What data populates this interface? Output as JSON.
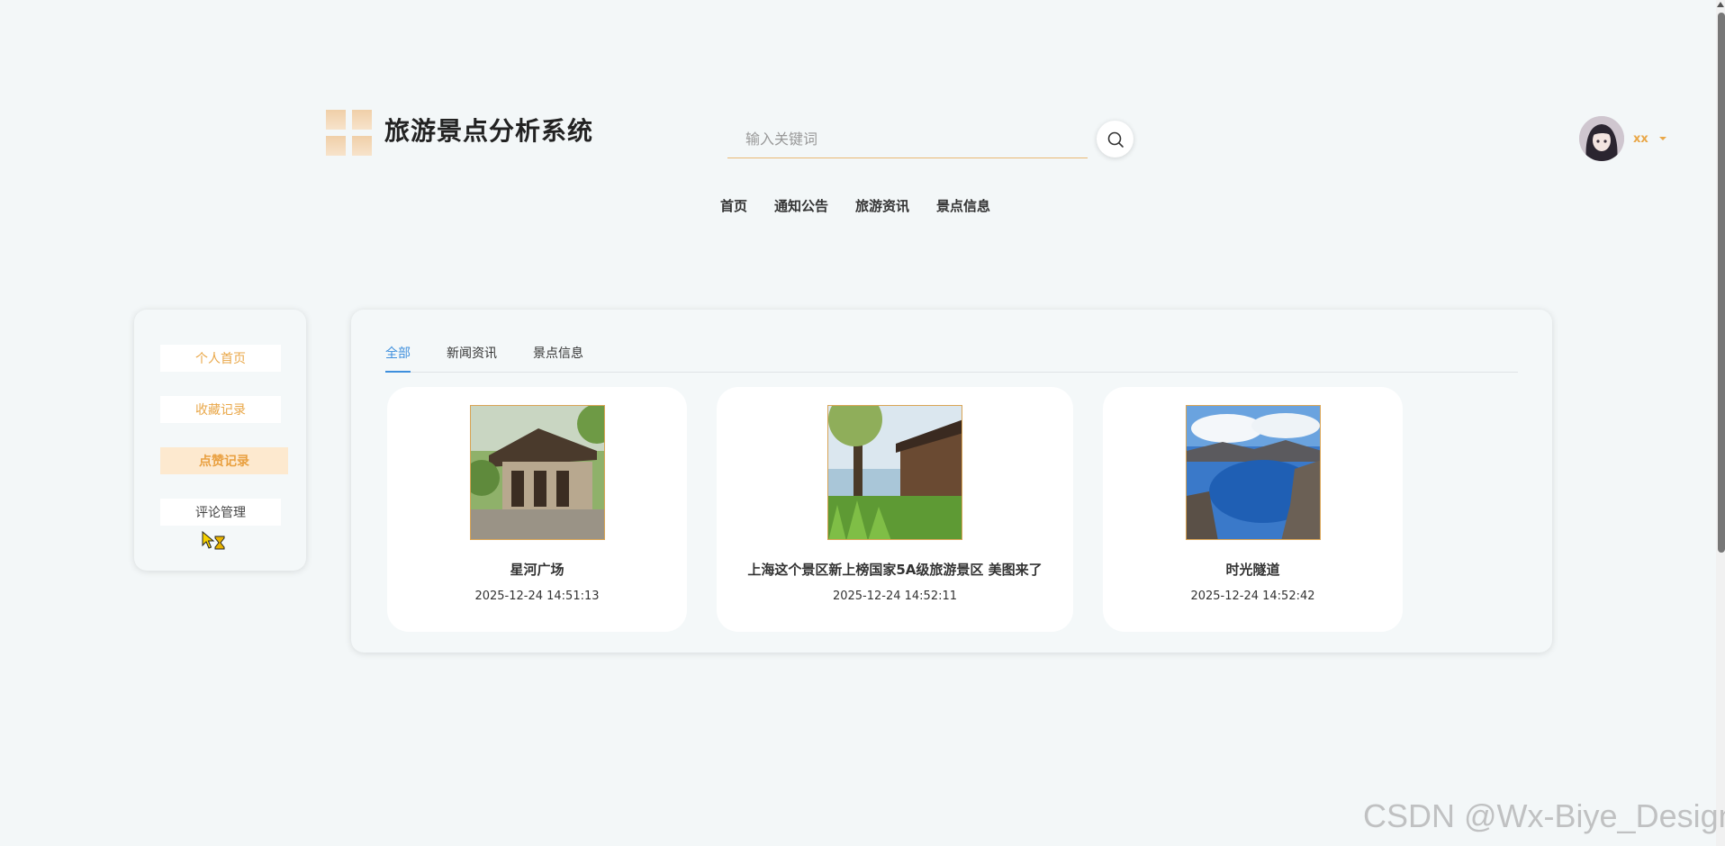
{
  "header": {
    "site_title": "旅游景点分析系统",
    "search_placeholder": "输入关键词",
    "nav": [
      "首页",
      "通知公告",
      "旅游资讯",
      "景点信息"
    ],
    "username": "xx"
  },
  "sidebar": {
    "items": [
      {
        "label": "个人首页",
        "active": false
      },
      {
        "label": "收藏记录",
        "active": false
      },
      {
        "label": "点赞记录",
        "active": true
      },
      {
        "label": "评论管理",
        "active": false
      }
    ]
  },
  "content": {
    "tabs": [
      {
        "label": "全部",
        "active": true
      },
      {
        "label": "新闻资讯",
        "active": false
      },
      {
        "label": "景点信息",
        "active": false
      }
    ],
    "cards": [
      {
        "title": "星河广场",
        "time": "2025-12-24 14:51:13"
      },
      {
        "title": "上海这个景区新上榜国家5A级旅游景区 美图来了",
        "time": "2025-12-24 14:52:11"
      },
      {
        "title": "时光隧道",
        "time": "2025-12-24 14:52:42"
      }
    ]
  },
  "watermark": "CSDN @Wx-Biye_Design",
  "colors": {
    "accent": "#e9a748",
    "tab_active": "#3e8fdd",
    "background": "#f3f7f8"
  }
}
